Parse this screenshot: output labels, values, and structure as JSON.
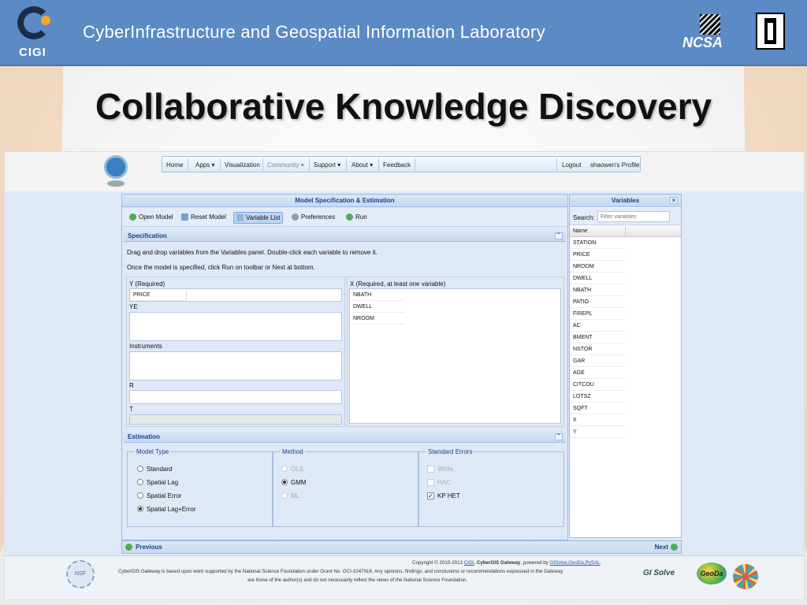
{
  "banner": {
    "logo_text": "CIGI",
    "title": "CyberInfrastructure and Geospatial Information Laboratory",
    "ncsa_text": "NCSA"
  },
  "slide": {
    "title": "Collaborative Knowledge Discovery"
  },
  "nav": {
    "items": [
      "Home",
      "Apps",
      "Visualization",
      "Community",
      "Support",
      "About",
      "Feedback"
    ],
    "logout": "Logout",
    "profile": "shaowen's Profile"
  },
  "model_panel": {
    "title": "Model Specification & Estimation",
    "toolbar": [
      "Open Model",
      "Reset Model",
      "Variable List",
      "Preferences",
      "Run"
    ],
    "specification": {
      "header": "Specification",
      "line1": "Drag and drop variables from the Variables panel. Double-click each variable to remove it.",
      "line2": "Once the model is specified, click Run on toolbar or Next at bottom.",
      "y_label": "Y (Required)",
      "y_values": [
        "PRICE"
      ],
      "ye_label": "YE",
      "instruments_label": "Instruments",
      "r_label": "R",
      "t_label": "T",
      "x_label": "X (Required, at least one variable)",
      "x_values": [
        "NBATH",
        "DWELL",
        "NROOM"
      ]
    },
    "estimation": {
      "header": "Estimation",
      "model_type": {
        "legend": "Model Type",
        "options": [
          "Standard",
          "Spatial Lag",
          "Spatial Error",
          "Spatial Lag+Error"
        ],
        "selected": "Spatial Lag+Error"
      },
      "method": {
        "legend": "Method",
        "options": [
          "OLS",
          "GMM",
          "ML"
        ],
        "selected": "GMM"
      },
      "standard_errors": {
        "legend": "Standard Errors",
        "options": [
          "White",
          "HAC",
          "KP HET"
        ],
        "checked": "KP HET"
      }
    },
    "previous": "Previous",
    "next": "Next"
  },
  "variables_panel": {
    "title": "Variables",
    "search_label": "Search:",
    "search_placeholder": "Filter variables",
    "column": "Name",
    "items": [
      "STATION",
      "PRICE",
      "NROOM",
      "DWELL",
      "NBATH",
      "PATIO",
      "FIREPL",
      "AC",
      "BMENT",
      "NSTOR",
      "GAR",
      "AGE",
      "CITCOU",
      "LOTSZ",
      "SQFT",
      "X",
      "Y"
    ]
  },
  "footer": {
    "copyright_prefix": "Copyright © 2010-2013 ",
    "cigi_link": "CIGI",
    "gateway": ". CyberGIS Gateway",
    "powered_by": ", powered by ",
    "powered_links": "GISolve,GeoDa,PySAL",
    "line2": "CyberGIS Gateway is based upon work supported by the National Science Foundation under Grant No. OCI-1047916. Any opinions, findings, and conclusions or recommendations expressed in the Gateway",
    "line3": "are those of the author(s) and do not necessarily reflect the views of the National Science Foundation.",
    "nsf_text": "NSF",
    "gisolve_text": "GI Solve",
    "geoda_text": "GeoDa"
  },
  "colors": {
    "banner": "#5b8ac4",
    "panel_header": "#15428b",
    "app_bg": "#dfe8f6"
  }
}
